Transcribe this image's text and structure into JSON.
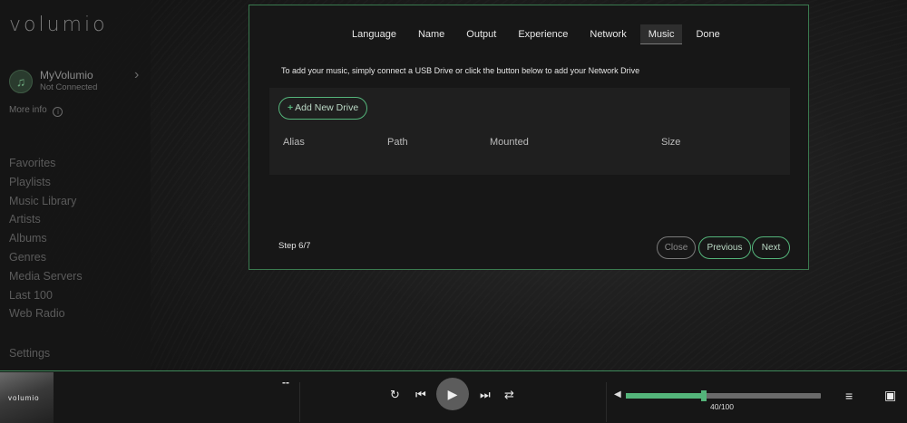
{
  "sidebar": {
    "logo": "volumio",
    "device_name": "MyVolumio",
    "device_status": "Not Connected",
    "more_info": "More info",
    "menu": [
      {
        "label": "Favorites"
      },
      {
        "label": "Playlists"
      },
      {
        "label": "Music Library"
      },
      {
        "label": "Artists"
      },
      {
        "label": "Albums"
      },
      {
        "label": "Genres"
      },
      {
        "label": "Media Servers"
      },
      {
        "label": "Last 100"
      },
      {
        "label": "Web Radio"
      }
    ],
    "settings": "Settings"
  },
  "wizard": {
    "tabs": [
      {
        "label": "Language"
      },
      {
        "label": "Name"
      },
      {
        "label": "Output"
      },
      {
        "label": "Experience"
      },
      {
        "label": "Network"
      },
      {
        "label": "Music",
        "active": true
      },
      {
        "label": "Done"
      }
    ],
    "intro": "To add your music, simply connect a USB Drive or click the button below to add your Network Drive",
    "add_drive": "Add New Drive",
    "columns": [
      "Alias",
      "Path",
      "Mounted",
      "Size"
    ],
    "step": "Step 6/7",
    "buttons": {
      "close": "Close",
      "previous": "Previous",
      "next": "Next"
    }
  },
  "player": {
    "album_logo": "volumio",
    "track_info": "--",
    "volume": 40,
    "volume_text": "40/100",
    "icons": {
      "repeat": "repeat-icon",
      "prev": "skip-previous-icon",
      "play": "play-icon",
      "next": "skip-next-icon",
      "shuffle": "shuffle-icon",
      "volume": "volume-icon",
      "queue": "queue-icon",
      "devices": "speaker-icon"
    }
  },
  "colors": {
    "accent": "#54b47a",
    "border": "#3a7a4f"
  }
}
